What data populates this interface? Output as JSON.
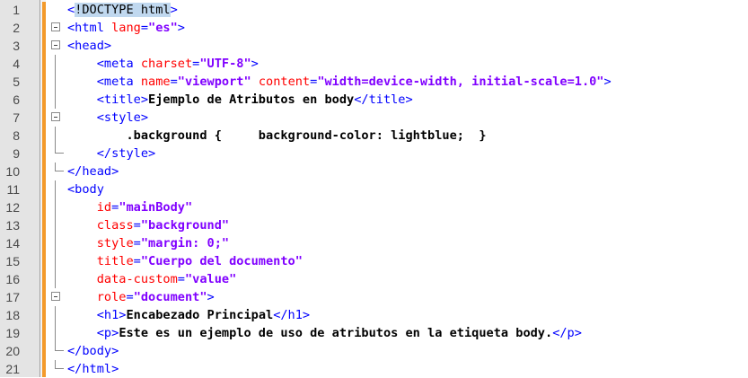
{
  "editor": {
    "lines": [
      {
        "n": "1",
        "segments": [
          {
            "t": "<",
            "c": "doctype-bracket"
          },
          {
            "t": "!DOCTYPE html",
            "c": "doctype"
          },
          {
            "t": ">",
            "c": "doctype-bracket"
          }
        ]
      },
      {
        "n": "2",
        "segments": [
          {
            "t": "<html ",
            "c": "tag"
          },
          {
            "t": "lang",
            "c": "attr"
          },
          {
            "t": "=",
            "c": "tag"
          },
          {
            "t": "\"es\"",
            "c": "val"
          },
          {
            "t": ">",
            "c": "tag"
          }
        ]
      },
      {
        "n": "3",
        "segments": [
          {
            "t": "<head>",
            "c": "tag"
          }
        ]
      },
      {
        "n": "4",
        "segments": [
          {
            "t": "    ",
            "c": "plain"
          },
          {
            "t": "<meta ",
            "c": "tag"
          },
          {
            "t": "charset",
            "c": "attr"
          },
          {
            "t": "=",
            "c": "tag"
          },
          {
            "t": "\"UTF-8\"",
            "c": "val"
          },
          {
            "t": ">",
            "c": "tag"
          }
        ]
      },
      {
        "n": "5",
        "segments": [
          {
            "t": "    ",
            "c": "plain"
          },
          {
            "t": "<meta ",
            "c": "tag"
          },
          {
            "t": "name",
            "c": "attr"
          },
          {
            "t": "=",
            "c": "tag"
          },
          {
            "t": "\"viewport\"",
            "c": "val"
          },
          {
            "t": " ",
            "c": "plain"
          },
          {
            "t": "content",
            "c": "attr"
          },
          {
            "t": "=",
            "c": "tag"
          },
          {
            "t": "\"width=device-width, initial-scale=1.0\"",
            "c": "val"
          },
          {
            "t": ">",
            "c": "tag"
          }
        ]
      },
      {
        "n": "6",
        "segments": [
          {
            "t": "    ",
            "c": "plain"
          },
          {
            "t": "<title>",
            "c": "tag"
          },
          {
            "t": "Ejemplo de Atributos en body",
            "c": "txt"
          },
          {
            "t": "</title>",
            "c": "tag"
          }
        ]
      },
      {
        "n": "7",
        "segments": [
          {
            "t": "    ",
            "c": "plain"
          },
          {
            "t": "<style>",
            "c": "tag"
          }
        ]
      },
      {
        "n": "8",
        "segments": [
          {
            "t": "        ",
            "c": "plain"
          },
          {
            "t": ".background {     background-color: lightblue;  }",
            "c": "txt"
          }
        ]
      },
      {
        "n": "9",
        "segments": [
          {
            "t": "    ",
            "c": "plain"
          },
          {
            "t": "</style>",
            "c": "tag"
          }
        ]
      },
      {
        "n": "10",
        "segments": [
          {
            "t": "</head>",
            "c": "tag"
          }
        ]
      },
      {
        "n": "11",
        "segments": [
          {
            "t": "<body",
            "c": "tag"
          }
        ]
      },
      {
        "n": "12",
        "segments": [
          {
            "t": "    ",
            "c": "plain"
          },
          {
            "t": "id",
            "c": "attr"
          },
          {
            "t": "=",
            "c": "tag"
          },
          {
            "t": "\"mainBody\"",
            "c": "val"
          }
        ]
      },
      {
        "n": "13",
        "segments": [
          {
            "t": "    ",
            "c": "plain"
          },
          {
            "t": "class",
            "c": "attr"
          },
          {
            "t": "=",
            "c": "tag"
          },
          {
            "t": "\"background\"",
            "c": "val"
          }
        ]
      },
      {
        "n": "14",
        "segments": [
          {
            "t": "    ",
            "c": "plain"
          },
          {
            "t": "style",
            "c": "attr"
          },
          {
            "t": "=",
            "c": "tag"
          },
          {
            "t": "\"margin: 0;\"",
            "c": "val"
          }
        ]
      },
      {
        "n": "15",
        "segments": [
          {
            "t": "    ",
            "c": "plain"
          },
          {
            "t": "title",
            "c": "attr"
          },
          {
            "t": "=",
            "c": "tag"
          },
          {
            "t": "\"Cuerpo del documento\"",
            "c": "val"
          }
        ]
      },
      {
        "n": "16",
        "segments": [
          {
            "t": "    ",
            "c": "plain"
          },
          {
            "t": "data-custom",
            "c": "attr"
          },
          {
            "t": "=",
            "c": "tag"
          },
          {
            "t": "\"value\"",
            "c": "val"
          }
        ]
      },
      {
        "n": "17",
        "segments": [
          {
            "t": "    ",
            "c": "plain"
          },
          {
            "t": "role",
            "c": "attr"
          },
          {
            "t": "=",
            "c": "tag"
          },
          {
            "t": "\"document\"",
            "c": "val"
          },
          {
            "t": ">",
            "c": "tag"
          }
        ]
      },
      {
        "n": "18",
        "segments": [
          {
            "t": "    ",
            "c": "plain"
          },
          {
            "t": "<h1>",
            "c": "tag"
          },
          {
            "t": "Encabezado Principal",
            "c": "txt"
          },
          {
            "t": "</h1>",
            "c": "tag"
          }
        ]
      },
      {
        "n": "19",
        "segments": [
          {
            "t": "    ",
            "c": "plain"
          },
          {
            "t": "<p>",
            "c": "tag"
          },
          {
            "t": "Este es un ejemplo de uso de atributos en la etiqueta body.",
            "c": "txt"
          },
          {
            "t": "</p>",
            "c": "tag"
          }
        ]
      },
      {
        "n": "20",
        "segments": [
          {
            "t": "</body>",
            "c": "tag"
          }
        ]
      },
      {
        "n": "21",
        "segments": [
          {
            "t": "</html>",
            "c": "tag"
          }
        ]
      }
    ],
    "folds": [
      "none",
      "box",
      "box",
      "line",
      "line",
      "line",
      "box",
      "line",
      "end",
      "end",
      "line",
      "line",
      "line",
      "line",
      "line",
      "line",
      "box",
      "line",
      "line",
      "end",
      "end"
    ],
    "colors": {
      "tag": "#0000ff",
      "attribute": "#ff0000",
      "value": "#8000ff",
      "text": "#000000",
      "change_bar": "#f39a2b",
      "doctype_highlight": "#c0d8ef"
    }
  }
}
